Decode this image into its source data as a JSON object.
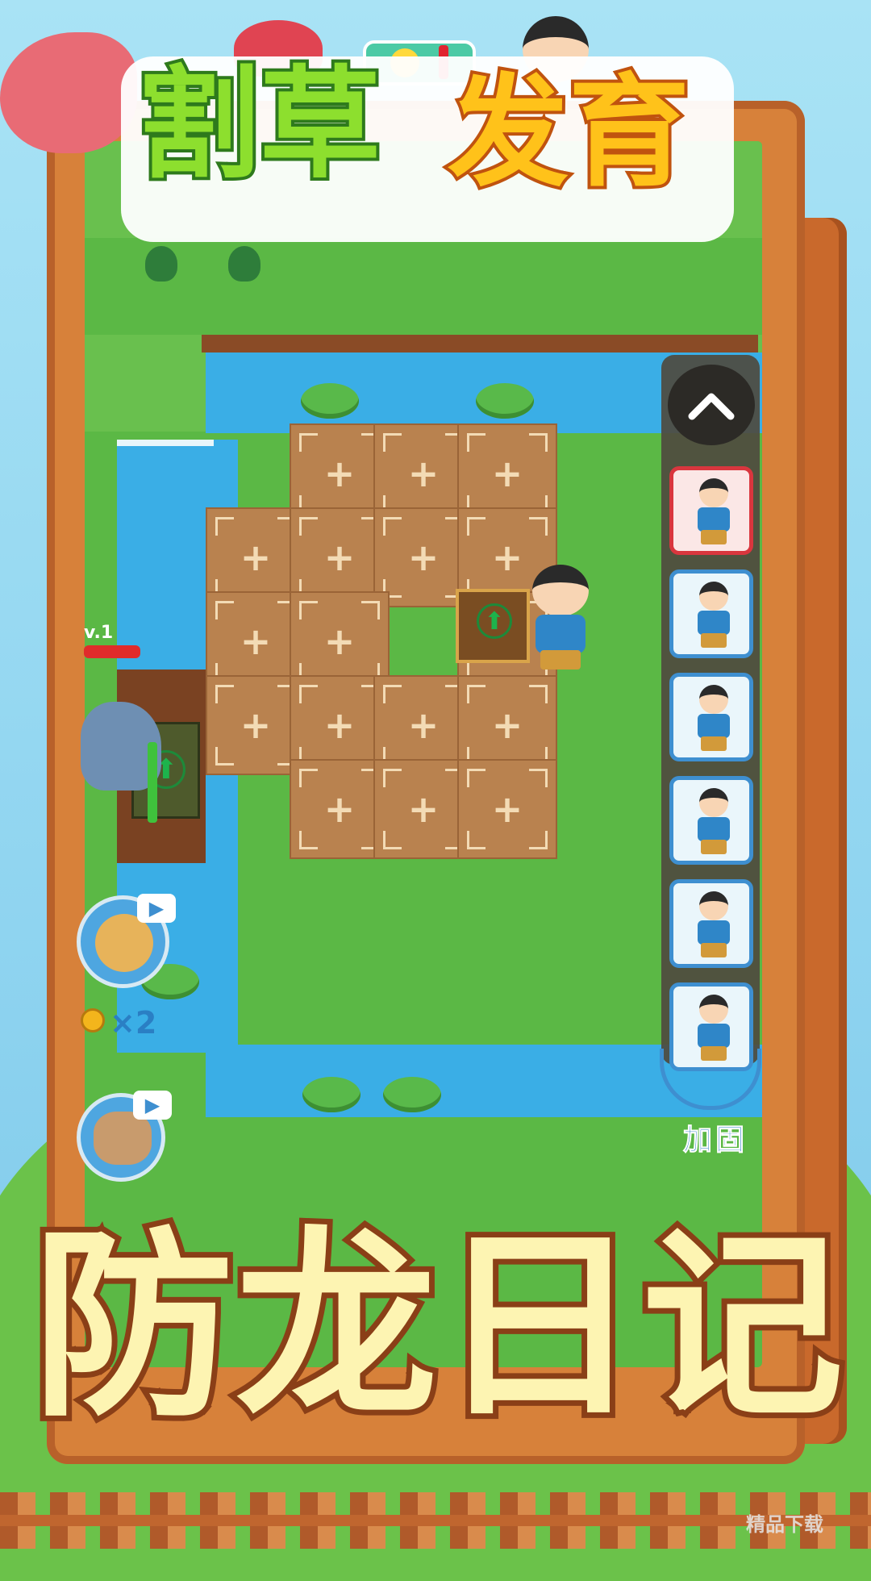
{
  "title": {
    "green": "割草",
    "orange": "发育"
  },
  "subtitle": "防龙日记",
  "enemy_level": "v.1",
  "reward_multiplier": "×2",
  "side_panel": {
    "up_icon": "chevron-up-icon",
    "reinforce_label": "加固",
    "slot_count": 6
  },
  "watermark": "精品下载",
  "colors": {
    "accent_green": "#8ddf2e",
    "accent_orange": "#ffc21a",
    "water": "#3aaee6",
    "panel_border": "#3e8fd0"
  }
}
